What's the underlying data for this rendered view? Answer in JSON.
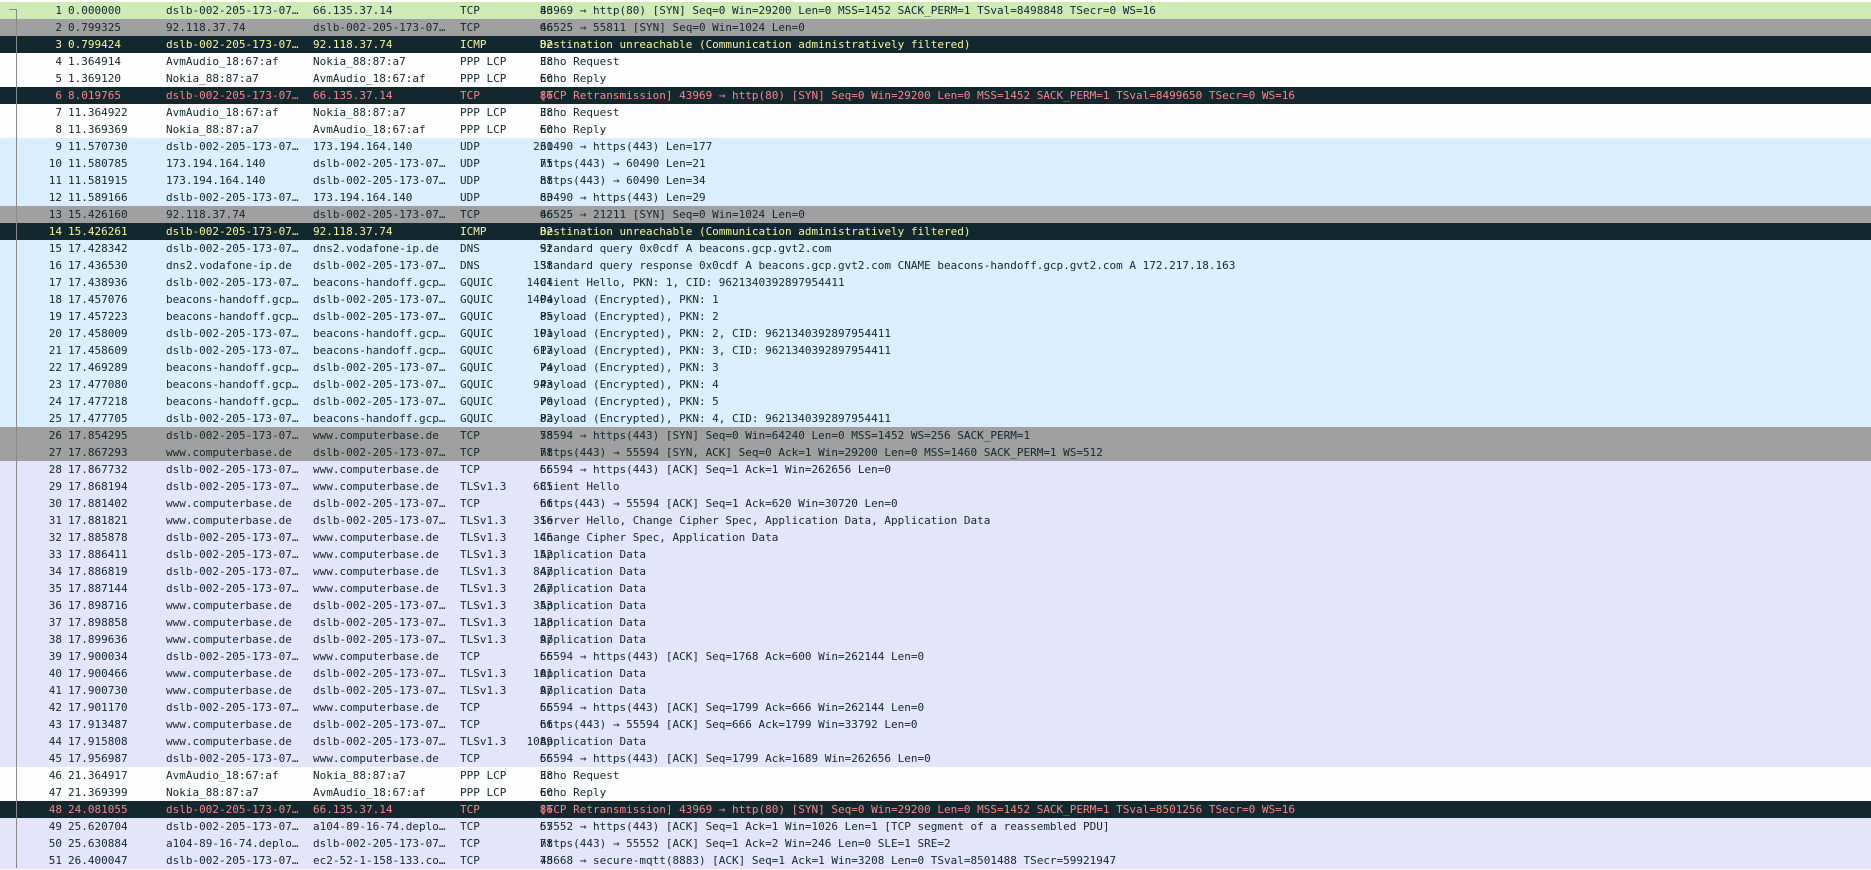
{
  "colors": {
    "k-green": "#d0eab5",
    "k-grey": "#a0a0a0",
    "k-black": "#12272e",
    "k-badtcp": "#12272e",
    "k-white": "#fefefe",
    "k-udp": "#daeeff",
    "k-tcp": "#e4e4fb"
  },
  "packets": [
    {
      "no": "1",
      "time": "0.000000",
      "src": "dslb-002-205-173-07…",
      "dst": "66.135.37.14",
      "proto": "TCP",
      "len": "86",
      "info": "43969 → http(80) [SYN] Seq=0 Win=29200 Len=0 MSS=1452 SACK_PERM=1 TSval=8498848 TSecr=0 WS=16",
      "k": "k-green"
    },
    {
      "no": "2",
      "time": "0.799325",
      "src": "92.118.37.74",
      "dst": "dslb-002-205-173-07…",
      "proto": "TCP",
      "len": "66",
      "info": "46525 → 55811 [SYN] Seq=0 Win=1024 Len=0",
      "k": "k-grey"
    },
    {
      "no": "3",
      "time": "0.799424",
      "src": "dslb-002-205-173-07…",
      "dst": "92.118.37.74",
      "proto": "ICMP",
      "len": "82",
      "info": "Destination unreachable (Communication administratively filtered)",
      "k": "k-black"
    },
    {
      "no": "4",
      "time": "1.364914",
      "src": "AvmAudio_18:67:af",
      "dst": "Nokia_88:87:a7",
      "proto": "PPP LCP",
      "len": "38",
      "info": "Echo Request",
      "k": "k-white"
    },
    {
      "no": "5",
      "time": "1.369120",
      "src": "Nokia_88:87:a7",
      "dst": "AvmAudio_18:67:af",
      "proto": "PPP LCP",
      "len": "60",
      "info": "Echo Reply",
      "k": "k-white"
    },
    {
      "no": "6",
      "time": "8.019765",
      "src": "dslb-002-205-173-07…",
      "dst": "66.135.37.14",
      "proto": "TCP",
      "len": "86",
      "info": "[TCP Retransmission] 43969 → http(80) [SYN] Seq=0 Win=29200 Len=0 MSS=1452 SACK_PERM=1 TSval=8499650 TSecr=0 WS=16",
      "k": "k-badtcp"
    },
    {
      "no": "7",
      "time": "11.364922",
      "src": "AvmAudio_18:67:af",
      "dst": "Nokia_88:87:a7",
      "proto": "PPP LCP",
      "len": "38",
      "info": "Echo Request",
      "k": "k-white"
    },
    {
      "no": "8",
      "time": "11.369369",
      "src": "Nokia_88:87:a7",
      "dst": "AvmAudio_18:67:af",
      "proto": "PPP LCP",
      "len": "60",
      "info": "Echo Reply",
      "k": "k-white"
    },
    {
      "no": "9",
      "time": "11.570730",
      "src": "dslb-002-205-173-07…",
      "dst": "173.194.164.140",
      "proto": "UDP",
      "len": "231",
      "info": "60490 → https(443) Len=177",
      "k": "k-udp"
    },
    {
      "no": "10",
      "time": "11.580785",
      "src": "173.194.164.140",
      "dst": "dslb-002-205-173-07…",
      "proto": "UDP",
      "len": "75",
      "info": "https(443) → 60490 Len=21",
      "k": "k-udp"
    },
    {
      "no": "11",
      "time": "11.581915",
      "src": "173.194.164.140",
      "dst": "dslb-002-205-173-07…",
      "proto": "UDP",
      "len": "88",
      "info": "https(443) → 60490 Len=34",
      "k": "k-udp"
    },
    {
      "no": "12",
      "time": "11.589166",
      "src": "dslb-002-205-173-07…",
      "dst": "173.194.164.140",
      "proto": "UDP",
      "len": "83",
      "info": "60490 → https(443) Len=29",
      "k": "k-udp"
    },
    {
      "no": "13",
      "time": "15.426160",
      "src": "92.118.37.74",
      "dst": "dslb-002-205-173-07…",
      "proto": "TCP",
      "len": "66",
      "info": "46525 → 21211 [SYN] Seq=0 Win=1024 Len=0",
      "k": "k-grey"
    },
    {
      "no": "14",
      "time": "15.426261",
      "src": "dslb-002-205-173-07…",
      "dst": "92.118.37.74",
      "proto": "ICMP",
      "len": "82",
      "info": "Destination unreachable (Communication administratively filtered)",
      "k": "k-black"
    },
    {
      "no": "15",
      "time": "17.428342",
      "src": "dslb-002-205-173-07…",
      "dst": "dns2.vodafone-ip.de",
      "proto": "DNS",
      "len": "92",
      "info": "Standard query 0x0cdf A beacons.gcp.gvt2.com",
      "k": "k-udp"
    },
    {
      "no": "16",
      "time": "17.436530",
      "src": "dns2.vodafone-ip.de",
      "dst": "dslb-002-205-173-07…",
      "proto": "DNS",
      "len": "138",
      "info": "Standard query response 0x0cdf A beacons.gcp.gvt2.com CNAME beacons-handoff.gcp.gvt2.com A 172.217.18.163",
      "k": "k-udp"
    },
    {
      "no": "17",
      "time": "17.438936",
      "src": "dslb-002-205-173-07…",
      "dst": "beacons-handoff.gcp…",
      "proto": "GQUIC",
      "len": "1404",
      "info": "Client Hello, PKN: 1, CID: 9621340392897954411",
      "k": "k-udp"
    },
    {
      "no": "18",
      "time": "17.457076",
      "src": "beacons-handoff.gcp…",
      "dst": "dslb-002-205-173-07…",
      "proto": "GQUIC",
      "len": "1404",
      "info": "Payload (Encrypted), PKN: 1",
      "k": "k-udp"
    },
    {
      "no": "19",
      "time": "17.457223",
      "src": "beacons-handoff.gcp…",
      "dst": "dslb-002-205-173-07…",
      "proto": "GQUIC",
      "len": "85",
      "info": "Payload (Encrypted), PKN: 2",
      "k": "k-udp"
    },
    {
      "no": "20",
      "time": "17.458009",
      "src": "dslb-002-205-173-07…",
      "dst": "beacons-handoff.gcp…",
      "proto": "GQUIC",
      "len": "101",
      "info": "Payload (Encrypted), PKN: 2, CID: 9621340392897954411",
      "k": "k-udp"
    },
    {
      "no": "21",
      "time": "17.458609",
      "src": "dslb-002-205-173-07…",
      "dst": "beacons-handoff.gcp…",
      "proto": "GQUIC",
      "len": "617",
      "info": "Payload (Encrypted), PKN: 3, CID: 9621340392897954411",
      "k": "k-udp"
    },
    {
      "no": "22",
      "time": "17.469289",
      "src": "beacons-handoff.gcp…",
      "dst": "dslb-002-205-173-07…",
      "proto": "GQUIC",
      "len": "74",
      "info": "Payload (Encrypted), PKN: 3",
      "k": "k-udp"
    },
    {
      "no": "23",
      "time": "17.477080",
      "src": "beacons-handoff.gcp…",
      "dst": "dslb-002-205-173-07…",
      "proto": "GQUIC",
      "len": "943",
      "info": "Payload (Encrypted), PKN: 4",
      "k": "k-udp"
    },
    {
      "no": "24",
      "time": "17.477218",
      "src": "beacons-handoff.gcp…",
      "dst": "dslb-002-205-173-07…",
      "proto": "GQUIC",
      "len": "70",
      "info": "Payload (Encrypted), PKN: 5",
      "k": "k-udp"
    },
    {
      "no": "25",
      "time": "17.477705",
      "src": "dslb-002-205-173-07…",
      "dst": "beacons-handoff.gcp…",
      "proto": "GQUIC",
      "len": "82",
      "info": "Payload (Encrypted), PKN: 4, CID: 9621340392897954411",
      "k": "k-udp"
    },
    {
      "no": "26",
      "time": "17.854295",
      "src": "dslb-002-205-173-07…",
      "dst": "www.computerbase.de",
      "proto": "TCP",
      "len": "78",
      "info": "55594 → https(443) [SYN] Seq=0 Win=64240 Len=0 MSS=1452 WS=256 SACK_PERM=1",
      "k": "k-grey"
    },
    {
      "no": "27",
      "time": "17.867293",
      "src": "www.computerbase.de",
      "dst": "dslb-002-205-173-07…",
      "proto": "TCP",
      "len": "78",
      "info": "https(443) → 55594 [SYN, ACK] Seq=0 Ack=1 Win=29200 Len=0 MSS=1460 SACK_PERM=1 WS=512",
      "k": "k-grey"
    },
    {
      "no": "28",
      "time": "17.867732",
      "src": "dslb-002-205-173-07…",
      "dst": "www.computerbase.de",
      "proto": "TCP",
      "len": "66",
      "info": "55594 → https(443) [ACK] Seq=1 Ack=1 Win=262656 Len=0",
      "k": "k-tcp"
    },
    {
      "no": "29",
      "time": "17.868194",
      "src": "dslb-002-205-173-07…",
      "dst": "www.computerbase.de",
      "proto": "TLSv1.3",
      "len": "685",
      "info": "Client Hello",
      "k": "k-tcp"
    },
    {
      "no": "30",
      "time": "17.881402",
      "src": "www.computerbase.de",
      "dst": "dslb-002-205-173-07…",
      "proto": "TCP",
      "len": "66",
      "info": "https(443) → 55594 [ACK] Seq=1 Ack=620 Win=30720 Len=0",
      "k": "k-tcp"
    },
    {
      "no": "31",
      "time": "17.881821",
      "src": "www.computerbase.de",
      "dst": "dslb-002-205-173-07…",
      "proto": "TLSv1.3",
      "len": "316",
      "info": "Server Hello, Change Cipher Spec, Application Data, Application Data",
      "k": "k-tcp"
    },
    {
      "no": "32",
      "time": "17.885878",
      "src": "dslb-002-205-173-07…",
      "dst": "www.computerbase.de",
      "proto": "TLSv1.3",
      "len": "146",
      "info": "Change Cipher Spec, Application Data",
      "k": "k-tcp"
    },
    {
      "no": "33",
      "time": "17.886411",
      "src": "dslb-002-205-173-07…",
      "dst": "www.computerbase.de",
      "proto": "TLSv1.3",
      "len": "152",
      "info": "Application Data",
      "k": "k-tcp"
    },
    {
      "no": "34",
      "time": "17.886819",
      "src": "dslb-002-205-173-07…",
      "dst": "www.computerbase.de",
      "proto": "TLSv1.3",
      "len": "847",
      "info": "Application Data",
      "k": "k-tcp"
    },
    {
      "no": "35",
      "time": "17.887144",
      "src": "dslb-002-205-173-07…",
      "dst": "www.computerbase.de",
      "proto": "TLSv1.3",
      "len": "267",
      "info": "Application Data",
      "k": "k-tcp"
    },
    {
      "no": "36",
      "time": "17.898716",
      "src": "www.computerbase.de",
      "dst": "dslb-002-205-173-07…",
      "proto": "TLSv1.3",
      "len": "353",
      "info": "Application Data",
      "k": "k-tcp"
    },
    {
      "no": "37",
      "time": "17.898858",
      "src": "www.computerbase.de",
      "dst": "dslb-002-205-173-07…",
      "proto": "TLSv1.3",
      "len": "128",
      "info": "Application Data",
      "k": "k-tcp"
    },
    {
      "no": "38",
      "time": "17.899636",
      "src": "www.computerbase.de",
      "dst": "dslb-002-205-173-07…",
      "proto": "TLSv1.3",
      "len": "97",
      "info": "Application Data",
      "k": "k-tcp"
    },
    {
      "no": "39",
      "time": "17.900034",
      "src": "dslb-002-205-173-07…",
      "dst": "www.computerbase.de",
      "proto": "TCP",
      "len": "66",
      "info": "55594 → https(443) [ACK] Seq=1768 Ack=600 Win=262144 Len=0",
      "k": "k-tcp"
    },
    {
      "no": "40",
      "time": "17.900466",
      "src": "www.computerbase.de",
      "dst": "dslb-002-205-173-07…",
      "proto": "TLSv1.3",
      "len": "101",
      "info": "Application Data",
      "k": "k-tcp"
    },
    {
      "no": "41",
      "time": "17.900730",
      "src": "www.computerbase.de",
      "dst": "dslb-002-205-173-07…",
      "proto": "TLSv1.3",
      "len": "97",
      "info": "Application Data",
      "k": "k-tcp"
    },
    {
      "no": "42",
      "time": "17.901170",
      "src": "dslb-002-205-173-07…",
      "dst": "www.computerbase.de",
      "proto": "TCP",
      "len": "66",
      "info": "55594 → https(443) [ACK] Seq=1799 Ack=666 Win=262144 Len=0",
      "k": "k-tcp"
    },
    {
      "no": "43",
      "time": "17.913487",
      "src": "www.computerbase.de",
      "dst": "dslb-002-205-173-07…",
      "proto": "TCP",
      "len": "66",
      "info": "https(443) → 55594 [ACK] Seq=666 Ack=1799 Win=33792 Len=0",
      "k": "k-tcp"
    },
    {
      "no": "44",
      "time": "17.915808",
      "src": "www.computerbase.de",
      "dst": "dslb-002-205-173-07…",
      "proto": "TLSv1.3",
      "len": "1089",
      "info": "Application Data",
      "k": "k-tcp"
    },
    {
      "no": "45",
      "time": "17.956987",
      "src": "dslb-002-205-173-07…",
      "dst": "www.computerbase.de",
      "proto": "TCP",
      "len": "66",
      "info": "55594 → https(443) [ACK] Seq=1799 Ack=1689 Win=262656 Len=0",
      "k": "k-tcp"
    },
    {
      "no": "46",
      "time": "21.364917",
      "src": "AvmAudio_18:67:af",
      "dst": "Nokia_88:87:a7",
      "proto": "PPP LCP",
      "len": "38",
      "info": "Echo Request",
      "k": "k-white"
    },
    {
      "no": "47",
      "time": "21.369399",
      "src": "Nokia_88:87:a7",
      "dst": "AvmAudio_18:67:af",
      "proto": "PPP LCP",
      "len": "60",
      "info": "Echo Reply",
      "k": "k-white"
    },
    {
      "no": "48",
      "time": "24.081055",
      "src": "dslb-002-205-173-07…",
      "dst": "66.135.37.14",
      "proto": "TCP",
      "len": "86",
      "info": "[TCP Retransmission] 43969 → http(80) [SYN] Seq=0 Win=29200 Len=0 MSS=1452 SACK_PERM=1 TSval=8501256 TSecr=0 WS=16",
      "k": "k-badtcp"
    },
    {
      "no": "49",
      "time": "25.620704",
      "src": "dslb-002-205-173-07…",
      "dst": "a104-89-16-74.deplo…",
      "proto": "TCP",
      "len": "67",
      "info": "55552 → https(443) [ACK] Seq=1 Ack=1 Win=1026 Len=1 [TCP segment of a reassembled PDU]",
      "k": "k-tcp"
    },
    {
      "no": "50",
      "time": "25.630884",
      "src": "a104-89-16-74.deplo…",
      "dst": "dslb-002-205-173-07…",
      "proto": "TCP",
      "len": "78",
      "info": "https(443) → 55552 [ACK] Seq=1 Ack=2 Win=246 Len=0 SLE=1 SRE=2",
      "k": "k-tcp"
    },
    {
      "no": "51",
      "time": "26.400047",
      "src": "dslb-002-205-173-07…",
      "dst": "ec2-52-1-158-133.co…",
      "proto": "TCP",
      "len": "78",
      "info": "45668 → secure-mqtt(8883) [ACK] Seq=1 Ack=1 Win=3208 Len=0 TSval=8501488 TSecr=59921947",
      "k": "k-tcp"
    }
  ]
}
